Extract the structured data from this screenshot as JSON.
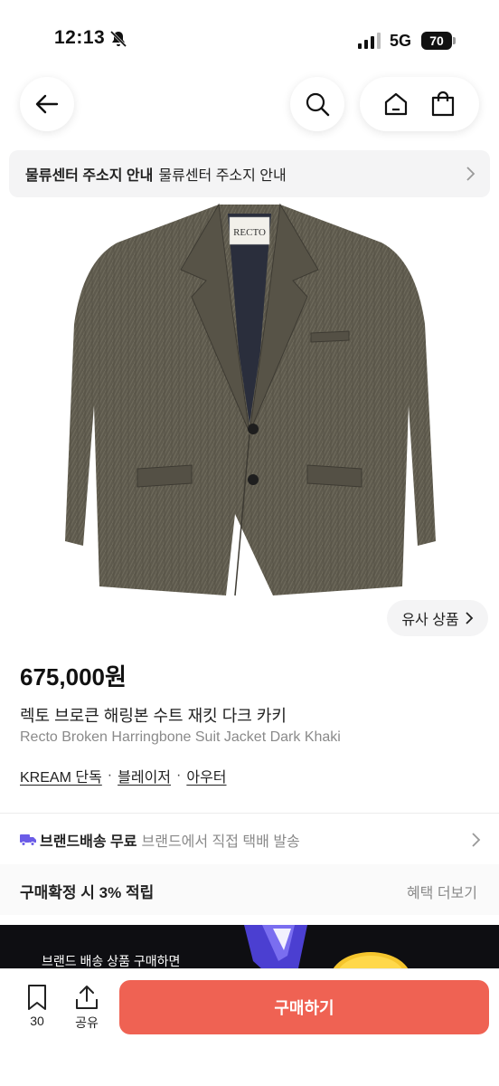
{
  "status_bar": {
    "time": "12:13",
    "network": "5G",
    "battery": "70"
  },
  "header": {
    "back_icon": "arrow-left-icon",
    "search_icon": "search-icon",
    "home_icon": "home-icon",
    "bag_icon": "shopping-bag-icon"
  },
  "notice": {
    "title": "물류센터 주소지 안내",
    "text": "물류센터 주소지 안내"
  },
  "product": {
    "image_label": "RECTO",
    "similar_button": "유사 상품",
    "price": "675,000원",
    "name_ko": "렉토 브로큰 해링본 수트 재킷 다크 카키",
    "name_en": "Recto Broken Harringbone Suit Jacket Dark Khaki",
    "tags": [
      "KREAM 단독",
      "블레이저",
      "아우터"
    ]
  },
  "shipping": {
    "label": "브랜드배송 무료",
    "desc": "브랜드에서 직접 택배 발송"
  },
  "benefit": {
    "title": "구매확정 시 3% 적립",
    "link": "혜택 더보기"
  },
  "banner": {
    "text": "브랜드 배송 상품 구매하면"
  },
  "bottom_bar": {
    "bookmark_count": "30",
    "share_label": "공유",
    "buy_label": "구매하기"
  },
  "colors": {
    "accent": "#ef6253",
    "truck": "#6b5ce7"
  }
}
